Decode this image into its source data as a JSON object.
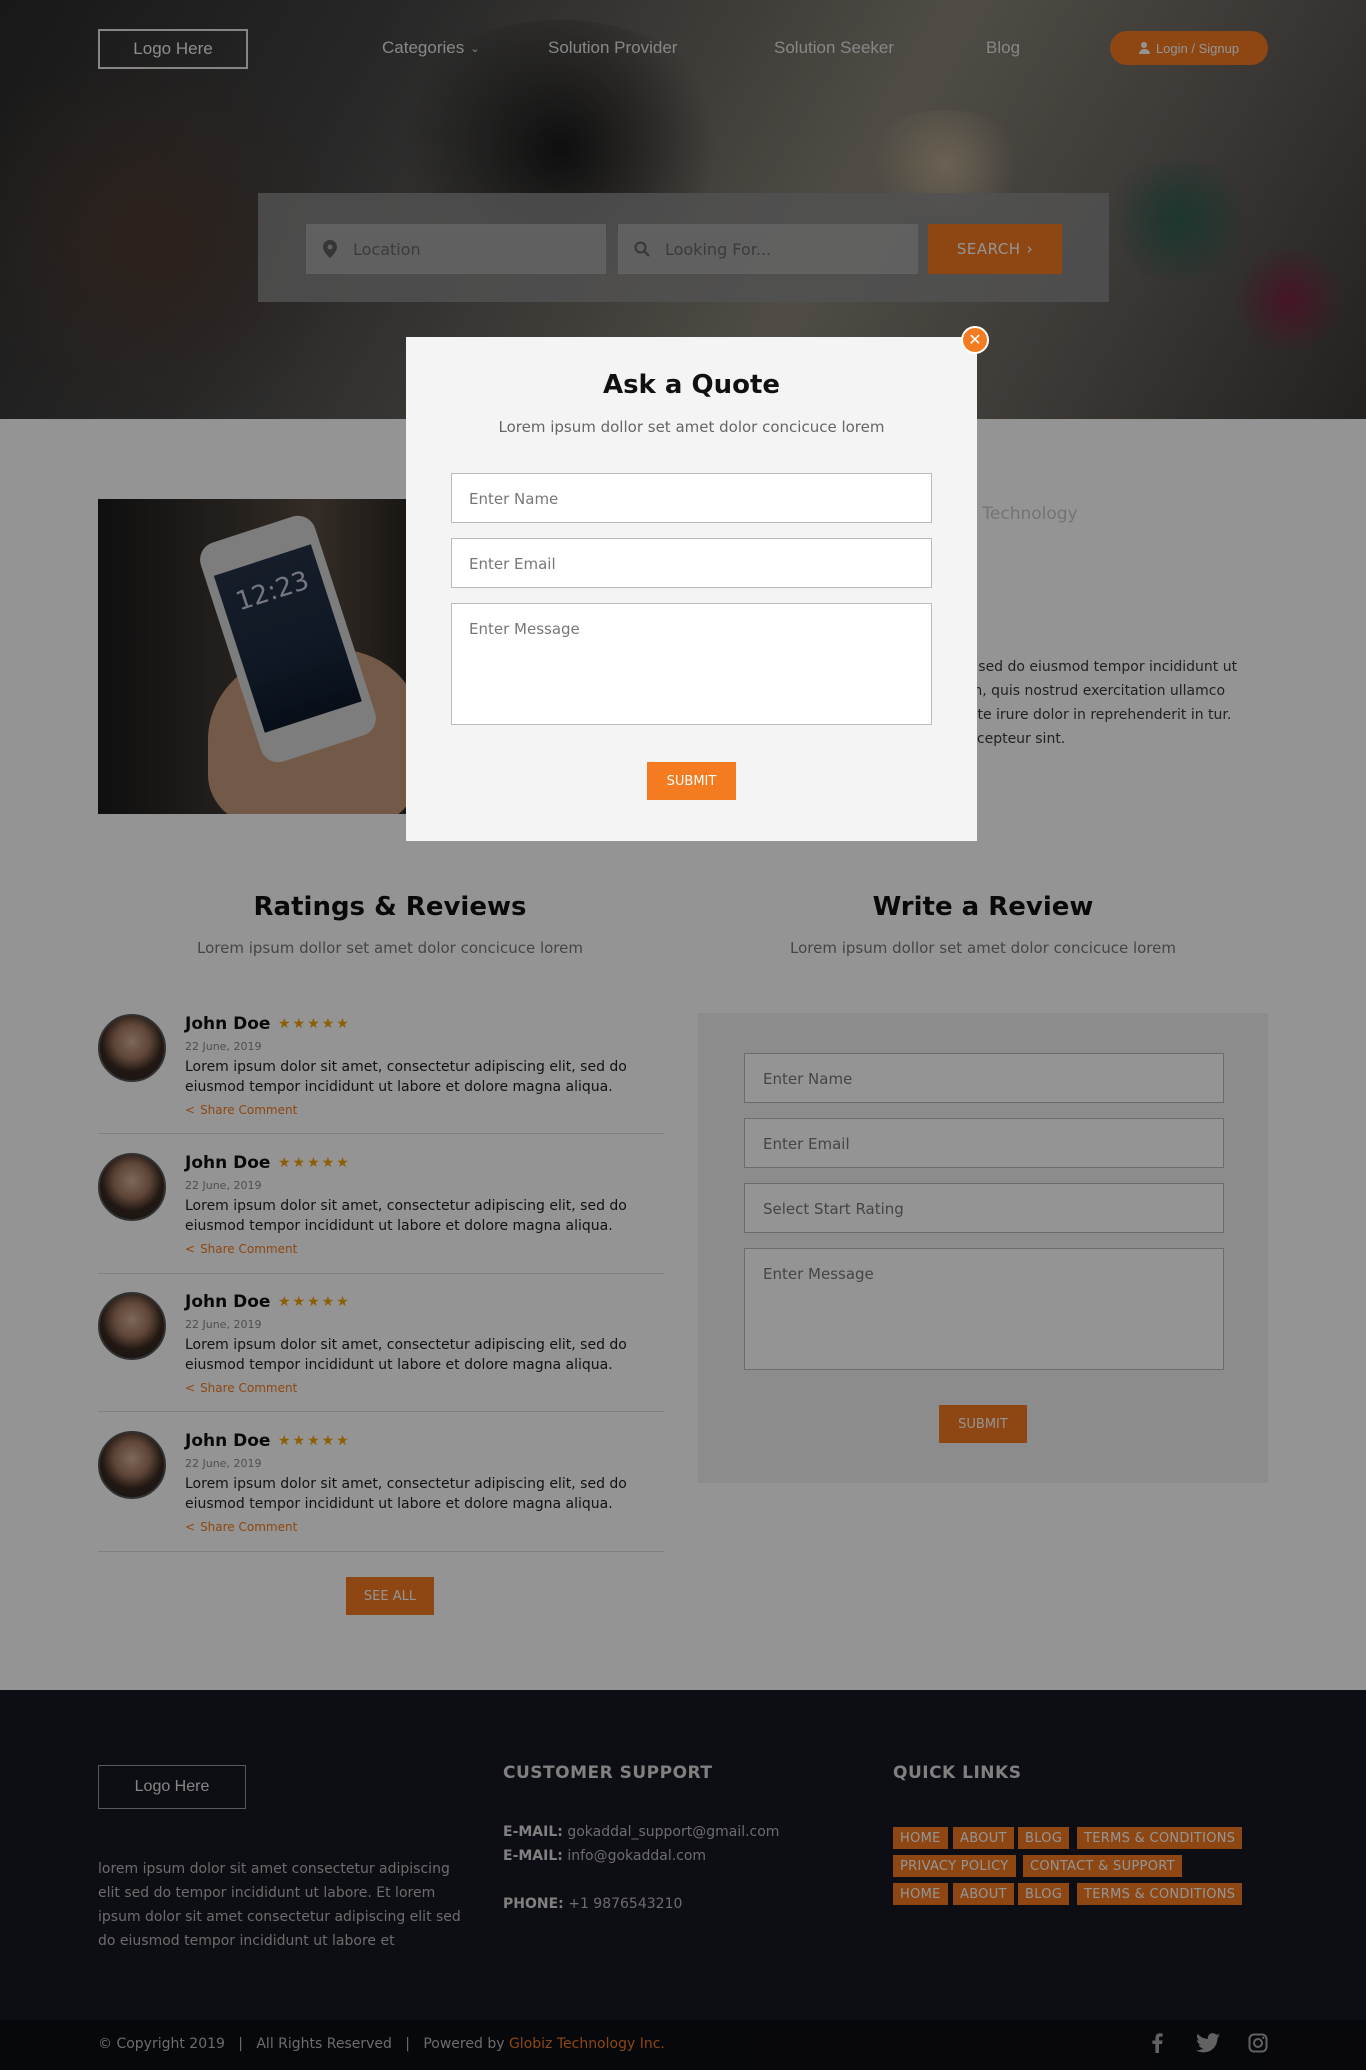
{
  "header": {
    "logo": "Logo Here",
    "nav": {
      "categories": "Categories",
      "provider": "Solution Provider",
      "seeker": "Solution Seeker",
      "blog": "Blog"
    },
    "login": "Login / Signup"
  },
  "search": {
    "location_placeholder": "Location",
    "looking_placeholder": "Looking For...",
    "button": "SEARCH"
  },
  "about": {
    "tech_text": "r Technology",
    "paragraph": "it, sed do eiusmod tempor incididunt ut am, quis nostrud exercitation ullamco aute irure dolor in reprehenderit in tur. Excepteur sint."
  },
  "ratings": {
    "title": "Ratings & Reviews",
    "subtitle": "Lorem ipsum dollor set amet dolor concicuce lorem",
    "reviews": [
      {
        "name": "John Doe",
        "stars": "★★★★★",
        "rating": 5,
        "date": "22 June, 2019",
        "text": "Lorem ipsum dolor sit amet, consectetur adipiscing elit, sed do eiusmod tempor incididunt ut labore et dolore magna aliqua.",
        "share": "Share Comment"
      },
      {
        "name": "John Doe",
        "stars": "★★★★★",
        "rating": 5,
        "date": "22 June, 2019",
        "text": "Lorem ipsum dolor sit amet, consectetur adipiscing elit, sed do eiusmod tempor incididunt ut labore et dolore magna aliqua.",
        "share": "Share Comment"
      },
      {
        "name": "John Doe",
        "stars": "★★★★★",
        "rating": 5,
        "date": "22 June, 2019",
        "text": "Lorem ipsum dolor sit amet, consectetur adipiscing elit, sed do eiusmod tempor incididunt ut labore et dolore magna aliqua.",
        "share": "Share Comment"
      },
      {
        "name": "John Doe",
        "stars": "★★★★★",
        "rating": 5,
        "date": "22 June, 2019",
        "text": "Lorem ipsum dolor sit amet, consectetur adipiscing elit, sed do eiusmod tempor incididunt ut labore et dolore magna aliqua.",
        "share": "Share Comment"
      }
    ],
    "see_all": "SEE ALL"
  },
  "write_review": {
    "title": "Write a Review",
    "subtitle": "Lorem ipsum dollor set amet dolor concicuce lorem",
    "name_placeholder": "Enter Name",
    "email_placeholder": "Enter Email",
    "rating_placeholder": "Select Start Rating",
    "message_placeholder": "Enter Message",
    "submit": "SUBMIT"
  },
  "modal": {
    "title": "Ask a Quote",
    "subtitle": "Lorem ipsum dollor set amet dolor concicuce lorem",
    "name_placeholder": "Enter Name",
    "email_placeholder": "Enter Email",
    "message_placeholder": "Enter Message",
    "submit": "SUBMIT",
    "close": "✕"
  },
  "footer": {
    "logo": "Logo Here",
    "about": "lorem ipsum dolor sit amet consectetur adipiscing elit sed do tempor incididunt ut labore.  Et lorem ipsum dolor sit amet consectetur adipiscing elit sed do eiusmod tempor incididunt ut labore et",
    "support_title": "CUSTOMER SUPPORT",
    "email_label": "E-MAIL:",
    "email1": "gokaddal_support@gmail.com",
    "email2": "info@gokaddal.com",
    "phone_label": "PHONE:",
    "phone": "+1 9876543210",
    "links_title": "QUICK LINKS",
    "links": [
      "HOME",
      "ABOUT",
      "BLOG",
      "TERMS & CONDITIONS",
      "PRIVACY POLICY",
      "CONTACT & SUPPORT",
      "HOME",
      "ABOUT",
      "BLOG",
      "TERMS & CONDITIONS"
    ]
  },
  "bottom": {
    "copyright": "© Copyright 2019   |   All Rights Reserved   |   Powered by ",
    "company": "Globiz Technology Inc."
  },
  "colors": {
    "accent": "#f47b20",
    "footer_bg": "#171823",
    "star": "#f2a20c"
  }
}
